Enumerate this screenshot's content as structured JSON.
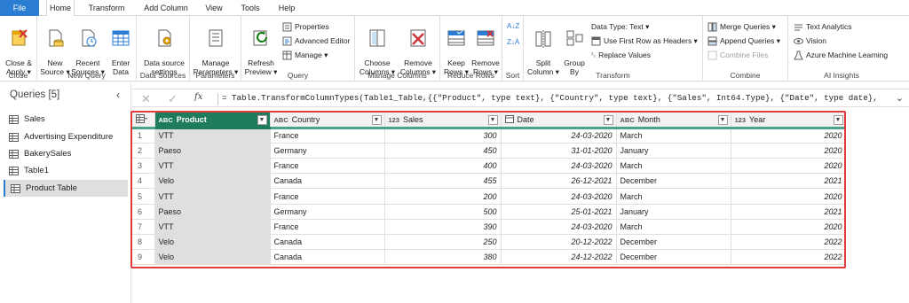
{
  "tabs": [
    "File",
    "Home",
    "Transform",
    "Add Column",
    "View",
    "Tools",
    "Help"
  ],
  "ribbon": {
    "close": {
      "close_apply": "Close &\nApply ▾",
      "label": "Close"
    },
    "new_query": {
      "new_source": "New\nSource ▾",
      "recent_sources": "Recent\nSources ▾",
      "enter_data": "Enter\nData",
      "label": "New Query"
    },
    "data_sources": {
      "settings": "Data source\nsettings",
      "label": "Data Sources"
    },
    "parameters": {
      "manage": "Manage\nParameters ▾",
      "label": "Parameters"
    },
    "query": {
      "refresh": "Refresh\nPreview ▾",
      "properties": "Properties",
      "advanced_editor": "Advanced Editor",
      "manage": "Manage ▾",
      "label": "Query"
    },
    "manage_columns": {
      "choose": "Choose\nColumns ▾",
      "remove": "Remove\nColumns ▾",
      "label": "Manage Columns"
    },
    "reduce_rows": {
      "keep": "Keep\nRows ▾",
      "remove": "Remove\nRows ▾",
      "label": "Reduce Rows"
    },
    "sort": {
      "label": "Sort"
    },
    "transform": {
      "split": "Split\nColumn ▾",
      "group_by": "Group\nBy",
      "data_type": "Data Type: Text ▾",
      "first_row": "Use First Row as Headers ▾",
      "replace": "Replace Values",
      "label": "Transform"
    },
    "combine": {
      "merge": "Merge Queries ▾",
      "append": "Append Queries ▾",
      "combine_files": "Combine Files",
      "label": "Combine"
    },
    "ai": {
      "text_analytics": "Text Analytics",
      "vision": "Vision",
      "azure_ml": "Azure Machine Learning",
      "label": "AI Insights"
    }
  },
  "queries": {
    "title": "Queries [5]",
    "items": [
      "Sales",
      "Advertising Expenditure",
      "BakerySales",
      "Table1",
      "Product Table"
    ]
  },
  "formula": "= Table.TransformColumnTypes(Table1_Table,{{\"Product\", type text}, {\"Country\", type text}, {\"Sales\", Int64.Type}, {\"Date\", type date},",
  "table": {
    "columns": [
      {
        "type": "ABC",
        "name": "Product"
      },
      {
        "type": "ABC",
        "name": "Country"
      },
      {
        "type": "123",
        "name": "Sales"
      },
      {
        "type": "",
        "name": "Date"
      },
      {
        "type": "ABC",
        "name": "Month"
      },
      {
        "type": "123",
        "name": "Year"
      }
    ],
    "rows": [
      [
        "1",
        "VTT",
        "France",
        "300",
        "24-03-2020",
        "March",
        "2020"
      ],
      [
        "2",
        "Paeso",
        "Germany",
        "450",
        "31-01-2020",
        "January",
        "2020"
      ],
      [
        "3",
        "VTT",
        "France",
        "400",
        "24-03-2020",
        "March",
        "2020"
      ],
      [
        "4",
        "Velo",
        "Canada",
        "455",
        "26-12-2021",
        "December",
        "2021"
      ],
      [
        "5",
        "VTT",
        "France",
        "200",
        "24-03-2020",
        "March",
        "2020"
      ],
      [
        "6",
        "Paeso",
        "Germany",
        "500",
        "25-01-2021",
        "January",
        "2021"
      ],
      [
        "7",
        "VTT",
        "France",
        "390",
        "24-03-2020",
        "March",
        "2020"
      ],
      [
        "8",
        "Velo",
        "Canada",
        "250",
        "20-12-2022",
        "December",
        "2022"
      ],
      [
        "9",
        "Velo",
        "Canada",
        "380",
        "24-12-2022",
        "December",
        "2022"
      ]
    ]
  }
}
